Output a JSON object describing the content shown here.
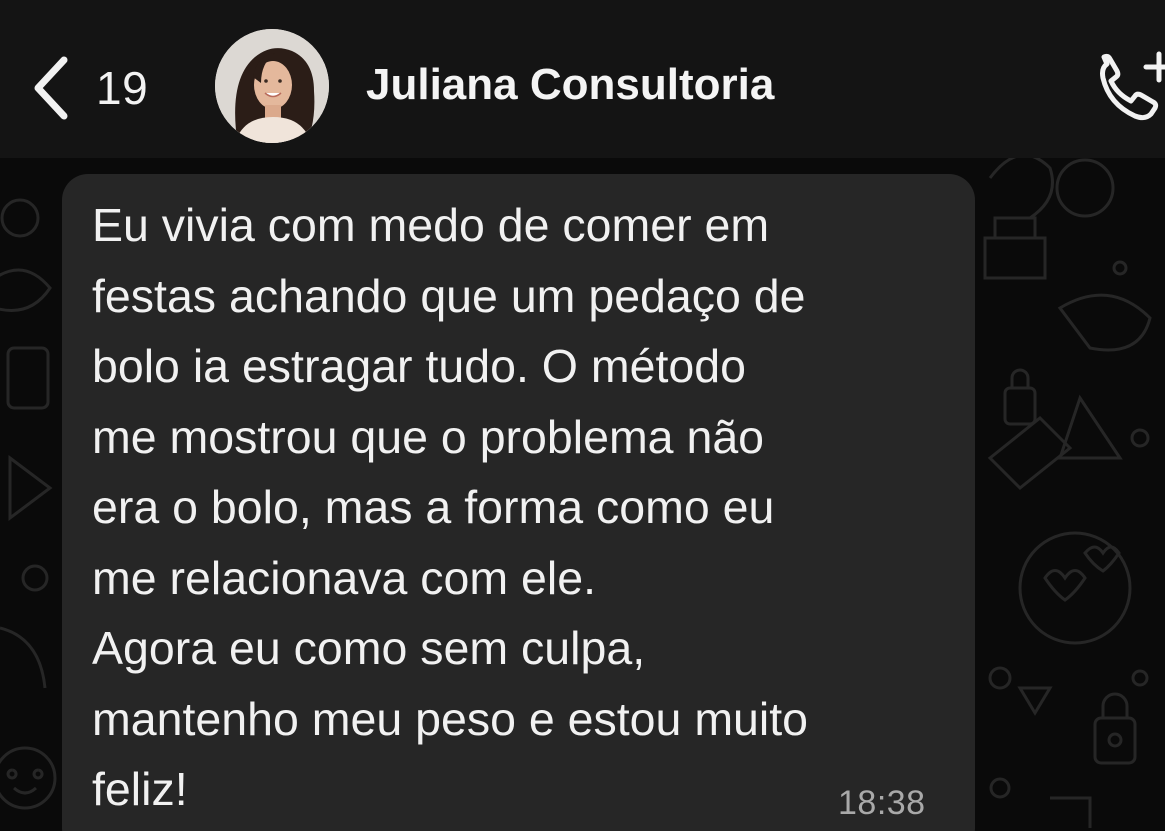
{
  "header": {
    "back_icon": "chevron-left-icon",
    "unread_count": "19",
    "avatar_icon": "contact-avatar",
    "contact_name": "Juliana Consultoria",
    "call_icon": "add-call-icon"
  },
  "chat": {
    "message": {
      "text": "Eu vivia com medo de comer em\nfestas achando que um pedaço de\nbolo ia estragar tudo. O método\nme mostrou que o problema não\nera o bolo, mas a forma como eu\nme relacionava com ele.\nAgora eu como sem culpa,\nmantenho meu peso e estou muito\nfeliz!",
      "time": "18:38"
    }
  },
  "colors": {
    "header_bg": "#141414",
    "chat_bg": "#0a0a0a",
    "bubble_bg": "#262626",
    "text": "#f1f1f1",
    "time_text": "#a9a9a9"
  }
}
